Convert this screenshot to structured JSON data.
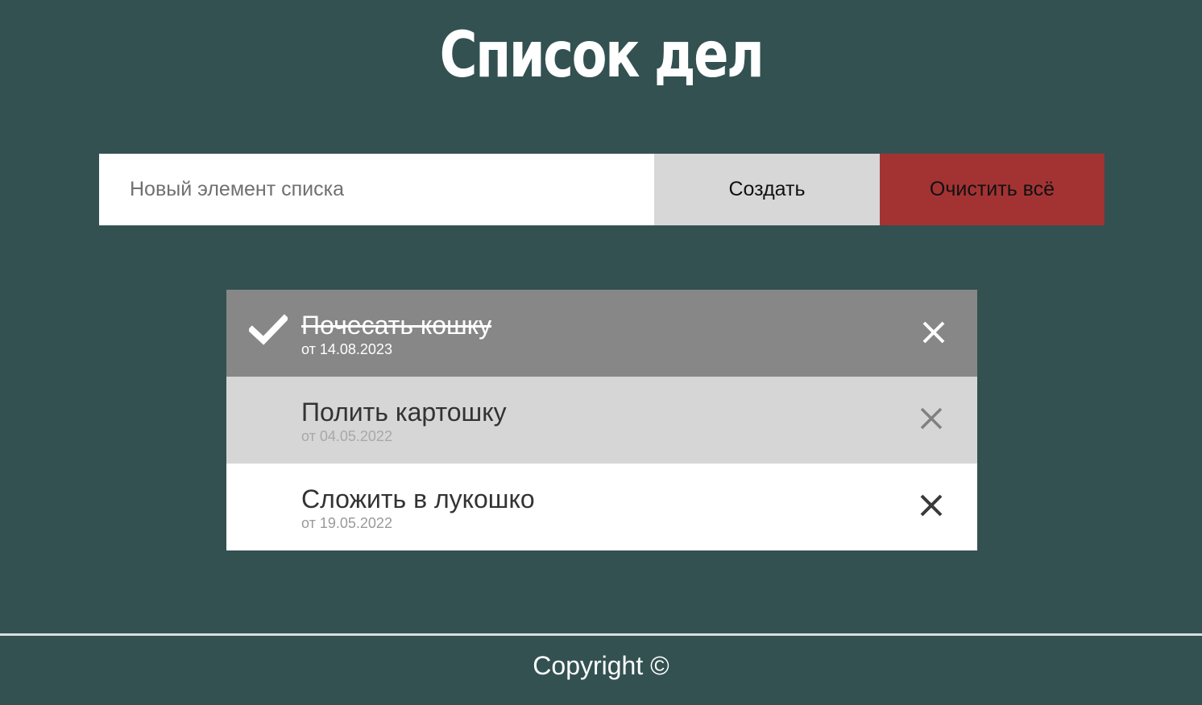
{
  "header": {
    "title": "Список дел"
  },
  "toolbar": {
    "input_placeholder": "Новый элемент списка",
    "input_value": "",
    "create_label": "Создать",
    "clear_label": "Очистить всё"
  },
  "items": [
    {
      "text": "Почесать кошку",
      "date": "от 14.08.2023",
      "done": true,
      "state": "done"
    },
    {
      "text": "Полить картошку",
      "date": "от 04.05.2022",
      "done": false,
      "state": "hover"
    },
    {
      "text": "Сложить в лукошко",
      "date": "от 19.05.2022",
      "done": false,
      "state": "normal"
    }
  ],
  "icons": {
    "check": "check-icon",
    "remove": "close-icon"
  },
  "colors": {
    "background": "#335151",
    "clear_button": "#a33333",
    "create_button": "#d7d7d7",
    "done_item": "#878787",
    "hover_item": "#d6d6d6"
  },
  "footer": {
    "copyright": "Copyright ©"
  }
}
